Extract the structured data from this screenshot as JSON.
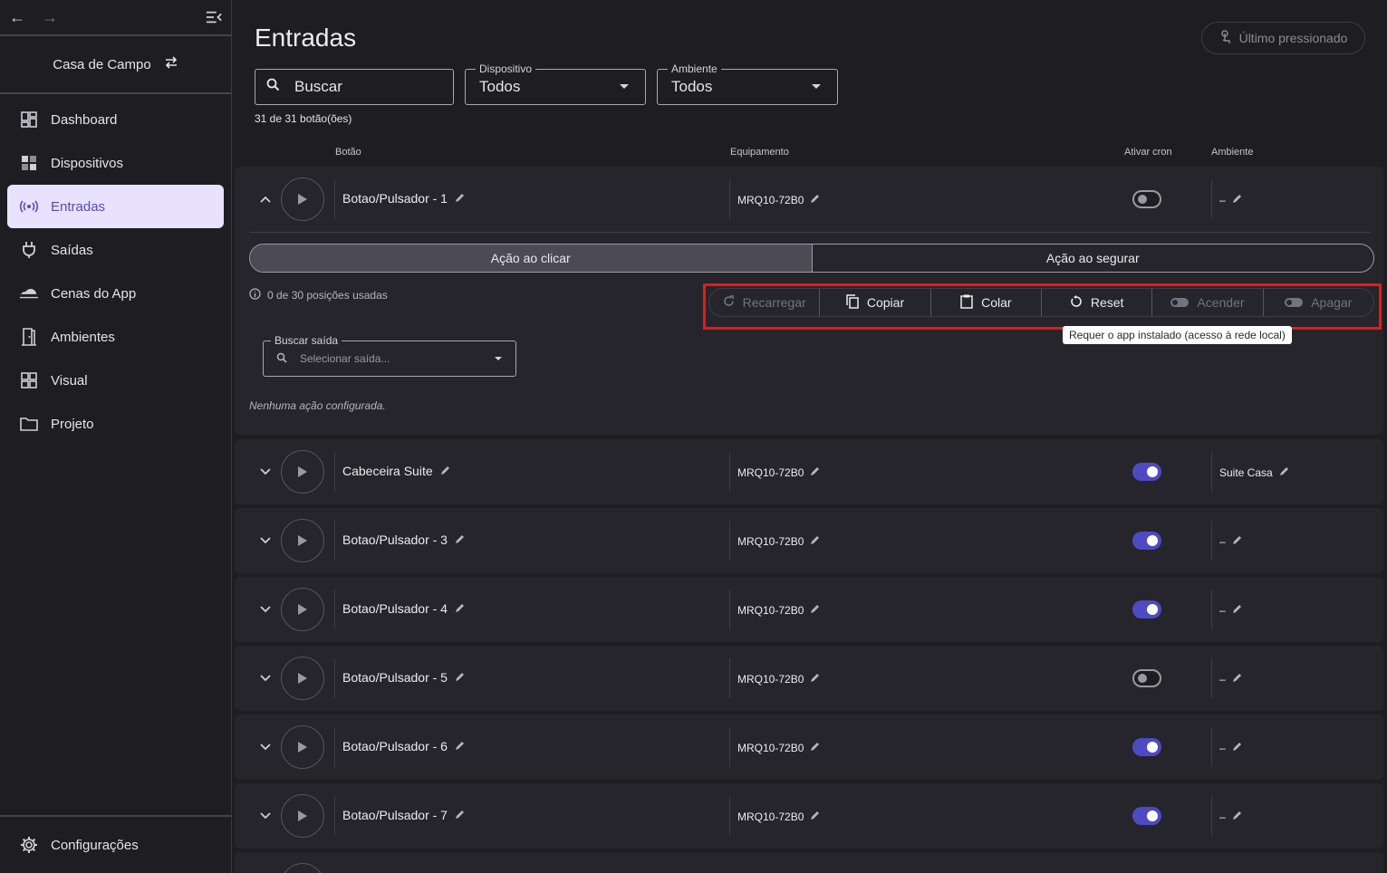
{
  "sidebar": {
    "project": "Casa de Campo",
    "items": [
      {
        "label": "Dashboard",
        "icon": "dashboard-icon"
      },
      {
        "label": "Dispositivos",
        "icon": "devices-icon"
      },
      {
        "label": "Entradas",
        "icon": "radio-signal-icon",
        "active": true
      },
      {
        "label": "Saídas",
        "icon": "plug-icon"
      },
      {
        "label": "Cenas do App",
        "icon": "cloud-scene-icon"
      },
      {
        "label": "Ambientes",
        "icon": "door-icon"
      },
      {
        "label": "Visual",
        "icon": "grid-icon"
      },
      {
        "label": "Projeto",
        "icon": "folder-icon"
      }
    ],
    "settings": "Configurações"
  },
  "header": {
    "title": "Entradas",
    "last_pressed": "Último pressionado"
  },
  "filters": {
    "search_placeholder": "Buscar",
    "device_label": "Dispositivo",
    "device_value": "Todos",
    "room_label": "Ambiente",
    "room_value": "Todos",
    "count": "31 de 31 botão(ões)"
  },
  "columns": {
    "button": "Botão",
    "equipment": "Equipamento",
    "cron": "Ativar cron",
    "room": "Ambiente"
  },
  "rows": [
    {
      "name": "Botao/Pulsador - 1",
      "equipment": "MRQ10-72B0",
      "cron": false,
      "room": "–",
      "expanded": true
    },
    {
      "name": "Cabeceira Suite",
      "equipment": "MRQ10-72B0",
      "cron": true,
      "room": "Suite Casa"
    },
    {
      "name": "Botao/Pulsador - 3",
      "equipment": "MRQ10-72B0",
      "cron": true,
      "room": "–"
    },
    {
      "name": "Botao/Pulsador - 4",
      "equipment": "MRQ10-72B0",
      "cron": true,
      "room": "–"
    },
    {
      "name": "Botao/Pulsador - 5",
      "equipment": "MRQ10-72B0",
      "cron": false,
      "room": "–"
    },
    {
      "name": "Botao/Pulsador - 6",
      "equipment": "MRQ10-72B0",
      "cron": true,
      "room": "–"
    },
    {
      "name": "Botao/Pulsador - 7",
      "equipment": "MRQ10-72B0",
      "cron": true,
      "room": "–"
    }
  ],
  "expanded": {
    "tab_click": "Ação ao clicar",
    "tab_hold": "Ação ao segurar",
    "positions": "0 de 30 posições usadas",
    "toolbar": {
      "reload": "Recarregar",
      "copy": "Copiar",
      "paste": "Colar",
      "reset": "Reset",
      "turn_on": "Acender",
      "turn_off": "Apagar"
    },
    "tooltip": "Requer o app instalado (acesso à rede local)",
    "search_output_label": "Buscar saída",
    "search_output_placeholder": "Selecionar saída...",
    "no_action": "Nenhuma ação configurada."
  },
  "colors": {
    "accent": "#4e4ac4",
    "active_nav_bg": "#e8e2ff",
    "highlight": "#e31b1b"
  }
}
